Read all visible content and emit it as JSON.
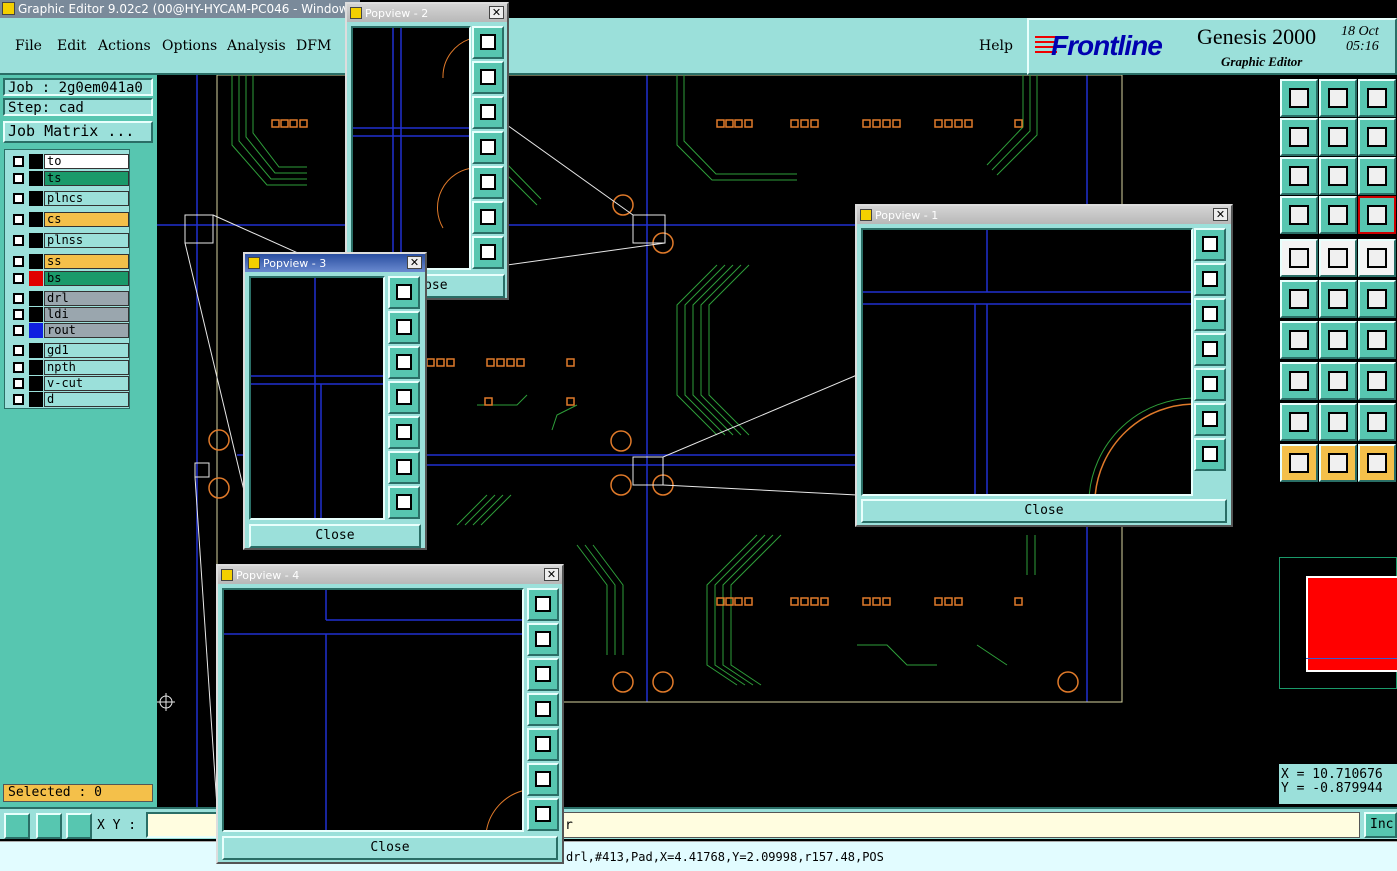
{
  "window": {
    "title": "Graphic Editor 9.02c2 (00@HY-HYCAM-PC046 - Windows, p"
  },
  "menu": {
    "file": "File",
    "edit": "Edit",
    "actions": "Actions",
    "options": "Options",
    "analysis": "Analysis",
    "dfm": "DFM",
    "help": "Help"
  },
  "brand": {
    "logo": "Frontline",
    "product": "Genesis 2000",
    "subtitle": "Graphic Editor",
    "date": "18 Oct",
    "time": "05:16"
  },
  "job": {
    "job_label": "Job : 2g0em041a0",
    "step_label": "Step: cad",
    "matrix_button": "Job Matrix ..."
  },
  "layers": [
    {
      "name": "to",
      "color": "#ffffff",
      "bg": "#ffffff"
    },
    {
      "name": "ts",
      "color": "#1a9a6a",
      "bg": "#1a9a6a"
    },
    {
      "name": "plncs",
      "color": "#9be0da",
      "bg": "#9be0da"
    },
    {
      "name": "cs",
      "color": "#f4c04a",
      "bg": "#f4c04a"
    },
    {
      "name": "plnss",
      "color": "#9be0da",
      "bg": "#9be0da"
    },
    {
      "name": "ss",
      "color": "#f4c04a",
      "bg": "#f4c04a"
    },
    {
      "name": "bs",
      "color": "#1a9a6a",
      "bg": "#1a9a6a"
    },
    {
      "name": "drl",
      "color": "#9aa6ae",
      "bg": "#9aa6ae"
    },
    {
      "name": "ldi",
      "color": "#9aa6ae",
      "bg": "#9aa6ae"
    },
    {
      "name": "rout",
      "color": "#9aa6ae",
      "bg": "#9aa6ae"
    },
    {
      "name": "gd1",
      "color": "#9be0da",
      "bg": "#9be0da"
    },
    {
      "name": "npth",
      "color": "#9be0da",
      "bg": "#9be0da"
    },
    {
      "name": "v-cut",
      "color": "#9be0da",
      "bg": "#9be0da"
    },
    {
      "name": "d",
      "color": "#9be0da",
      "bg": "#9be0da"
    }
  ],
  "selected": "Selected : 0",
  "coords": {
    "x": "X = 10.710676",
    "y": "Y = -0.879944"
  },
  "bottom": {
    "xy_label": "X Y :",
    "xy_value": "",
    "message": "r",
    "inc_button": "Inc"
  },
  "status": "drl,#413,Pad,X=4.41768,Y=2.09998,r157.48,POS",
  "popviews": [
    {
      "title": "Popview - 1",
      "close": "Close"
    },
    {
      "title": "Popview - 2",
      "close": "Close"
    },
    {
      "title": "Popview - 3",
      "close": "Close"
    },
    {
      "title": "Popview - 4",
      "close": "Close"
    }
  ],
  "colors": {
    "panel": "#9be0da",
    "panel_dark": "#57c6b0",
    "trace": "#2e9e3a",
    "pad": "#e07a2a",
    "grid_line": "#2030d0",
    "highlight": "#ff0000"
  }
}
